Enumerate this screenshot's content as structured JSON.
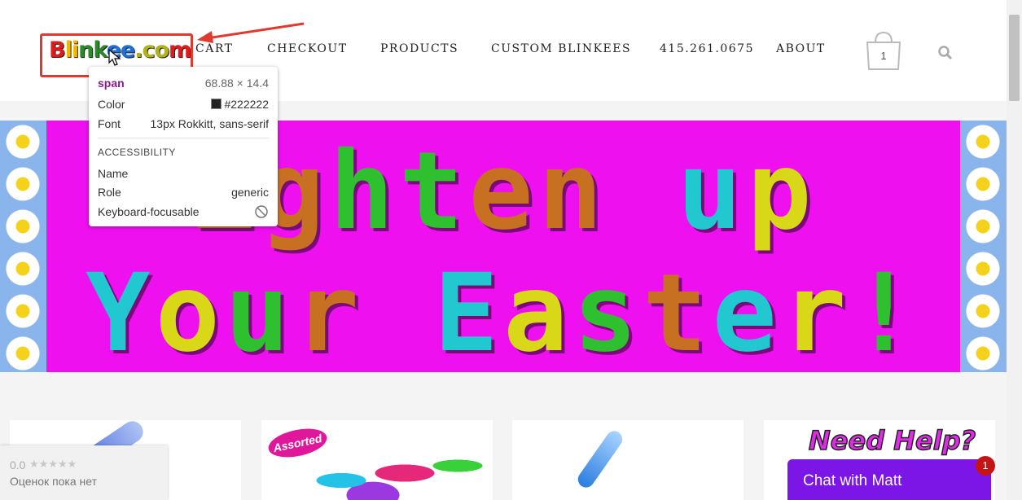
{
  "header": {
    "logo_text": "Blinkee.com",
    "nav": [
      "CART",
      "CHECKOUT",
      "PRODUCTS",
      "CUSTOM BLINKEES",
      "415.261.0675",
      "ABOUT"
    ],
    "cart_count": "1"
  },
  "devtools_tooltip": {
    "tag": "span",
    "dimensions": "68.88 × 14.4",
    "color_label": "Color",
    "color_value": "#222222",
    "font_label": "Font",
    "font_value": "13px Rokkitt, sans-serif",
    "section": "ACCESSIBILITY",
    "name_label": "Name",
    "role_label": "Role",
    "role_value": "generic",
    "focus_label": "Keyboard-focusable"
  },
  "banner": {
    "line1": "ighten up",
    "line2": "Your Easter!"
  },
  "rating_widget": {
    "score": "0.0",
    "stars": "★★★★★",
    "text": "Оценок пока нет"
  },
  "products": {
    "card1_label": "",
    "card2_badge": "Assorted",
    "need_help": "Need Help?"
  },
  "chat": {
    "label": "Chat with Matt",
    "badge": "1"
  },
  "colors": {
    "banner_bg": "#ee10ee",
    "chat_purple": "#7b16e6",
    "highlight_red": "#e03a30",
    "tooltip_tag": "#8a1a8a",
    "swatch": "#222222"
  }
}
